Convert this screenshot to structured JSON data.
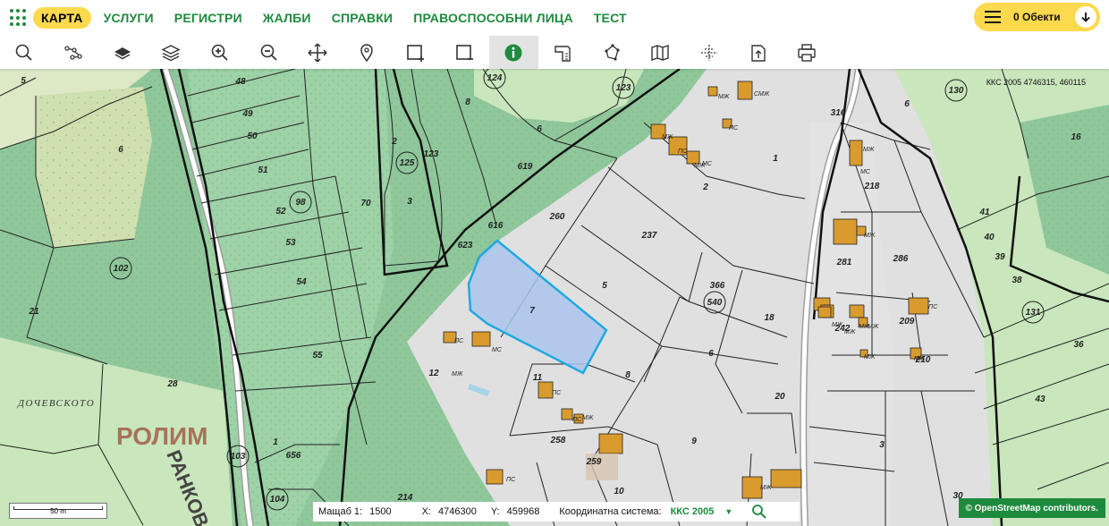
{
  "nav": {
    "items": [
      "КАРТА",
      "УСЛУГИ",
      "РЕГИСТРИ",
      "ЖАЛБИ",
      "СПРАВКИ",
      "ПРАВОСПОСОБНИ ЛИЦА",
      "ТЕСТ"
    ],
    "active_index": 0
  },
  "objects": {
    "label": "0 Обекти"
  },
  "toolbar": {
    "tools": [
      "search-icon",
      "route-icon",
      "layer-icon",
      "layers-stack-icon",
      "zoom-in-icon",
      "zoom-out-icon",
      "pan-icon",
      "location-pin-icon",
      "select-rectangle-icon",
      "deselect-rectangle-icon",
      "info-icon",
      "measure-icon",
      "polygon-icon",
      "map-icon",
      "grid-icon",
      "export-icon",
      "print-icon"
    ],
    "active_tool": "info-icon"
  },
  "map": {
    "coord_readout": "ККС 2005 4746315, 460115",
    "parcels": [
      "5",
      "48",
      "49",
      "50",
      "51",
      "52",
      "53",
      "54",
      "55",
      "6",
      "21",
      "28",
      "1",
      "656",
      "214",
      "70",
      "3",
      "2",
      "8",
      "6",
      "619",
      "616",
      "623",
      "260",
      "237",
      "5",
      "7",
      "8",
      "11",
      "258",
      "259",
      "10",
      "9",
      "6",
      "20",
      "3",
      "18",
      "366",
      "1",
      "2",
      "316",
      "218",
      "281",
      "286",
      "242",
      "209",
      "210",
      "6",
      "16",
      "41",
      "40",
      "39",
      "38",
      "36",
      "43",
      "30",
      "12",
      "123"
    ],
    "circled": [
      "124",
      "123",
      "125",
      "98",
      "102",
      "103",
      "104",
      "540",
      "130",
      "131"
    ],
    "building_tags": [
      "МЖ",
      "ПС",
      "СМЖ",
      "МЖ",
      "ПС",
      "МЖ",
      "МС",
      "МЖ",
      "МС",
      "МЖ",
      "МЖ",
      "МЖ",
      "МЖ",
      "МЖ",
      "ПС",
      "МЖ",
      "МЖ",
      "ПС",
      "МС",
      "ПС",
      "ПС",
      "МЖ",
      "ПС",
      "МЖ",
      "МЖ"
    ],
    "locality": "ДОЧЕВСКОТО",
    "area_label": "РОЛИМ",
    "street_label": "РАНКОВ",
    "selected_parcel": "7",
    "colors": {
      "forest": "#8fc79a",
      "forest_dark": "#7db98a",
      "meadow": "#c5e3ba",
      "urban": "#e0e0e0",
      "building": "#d99b2e",
      "selection_fill": "#a9c4ec",
      "selection_stroke": "#1fa9e0",
      "road": "#ffffff"
    }
  },
  "scale": {
    "label": "50 m"
  },
  "status": {
    "scale_label": "Мащаб 1:",
    "scale_value": "1500",
    "x_label": "X:",
    "x_value": "4746300",
    "y_label": "Y:",
    "y_value": "459968",
    "crs_label": "Координатна система:",
    "crs_value": "ККС 2005"
  },
  "attribution": "© OpenStreetMap contributors."
}
